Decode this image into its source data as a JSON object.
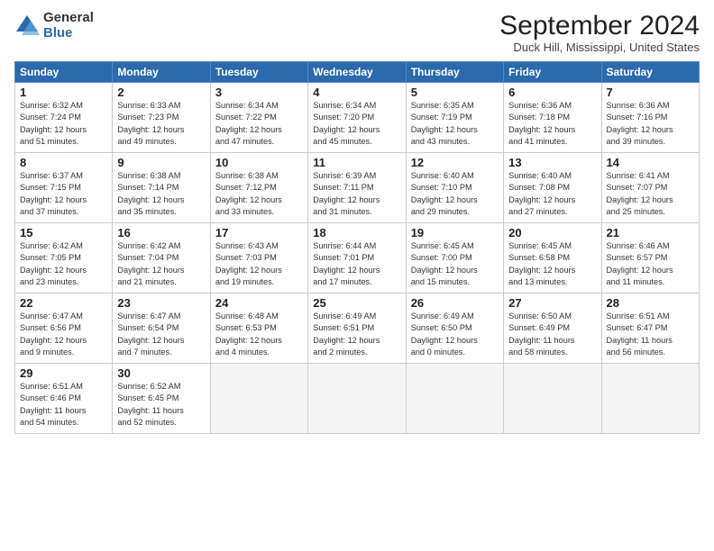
{
  "header": {
    "logo_general": "General",
    "logo_blue": "Blue",
    "month_title": "September 2024",
    "location": "Duck Hill, Mississippi, United States"
  },
  "days_of_week": [
    "Sunday",
    "Monday",
    "Tuesday",
    "Wednesday",
    "Thursday",
    "Friday",
    "Saturday"
  ],
  "weeks": [
    [
      {
        "day": "1",
        "info": "Sunrise: 6:32 AM\nSunset: 7:24 PM\nDaylight: 12 hours\nand 51 minutes."
      },
      {
        "day": "2",
        "info": "Sunrise: 6:33 AM\nSunset: 7:23 PM\nDaylight: 12 hours\nand 49 minutes."
      },
      {
        "day": "3",
        "info": "Sunrise: 6:34 AM\nSunset: 7:22 PM\nDaylight: 12 hours\nand 47 minutes."
      },
      {
        "day": "4",
        "info": "Sunrise: 6:34 AM\nSunset: 7:20 PM\nDaylight: 12 hours\nand 45 minutes."
      },
      {
        "day": "5",
        "info": "Sunrise: 6:35 AM\nSunset: 7:19 PM\nDaylight: 12 hours\nand 43 minutes."
      },
      {
        "day": "6",
        "info": "Sunrise: 6:36 AM\nSunset: 7:18 PM\nDaylight: 12 hours\nand 41 minutes."
      },
      {
        "day": "7",
        "info": "Sunrise: 6:36 AM\nSunset: 7:16 PM\nDaylight: 12 hours\nand 39 minutes."
      }
    ],
    [
      {
        "day": "8",
        "info": "Sunrise: 6:37 AM\nSunset: 7:15 PM\nDaylight: 12 hours\nand 37 minutes."
      },
      {
        "day": "9",
        "info": "Sunrise: 6:38 AM\nSunset: 7:14 PM\nDaylight: 12 hours\nand 35 minutes."
      },
      {
        "day": "10",
        "info": "Sunrise: 6:38 AM\nSunset: 7:12 PM\nDaylight: 12 hours\nand 33 minutes."
      },
      {
        "day": "11",
        "info": "Sunrise: 6:39 AM\nSunset: 7:11 PM\nDaylight: 12 hours\nand 31 minutes."
      },
      {
        "day": "12",
        "info": "Sunrise: 6:40 AM\nSunset: 7:10 PM\nDaylight: 12 hours\nand 29 minutes."
      },
      {
        "day": "13",
        "info": "Sunrise: 6:40 AM\nSunset: 7:08 PM\nDaylight: 12 hours\nand 27 minutes."
      },
      {
        "day": "14",
        "info": "Sunrise: 6:41 AM\nSunset: 7:07 PM\nDaylight: 12 hours\nand 25 minutes."
      }
    ],
    [
      {
        "day": "15",
        "info": "Sunrise: 6:42 AM\nSunset: 7:05 PM\nDaylight: 12 hours\nand 23 minutes."
      },
      {
        "day": "16",
        "info": "Sunrise: 6:42 AM\nSunset: 7:04 PM\nDaylight: 12 hours\nand 21 minutes."
      },
      {
        "day": "17",
        "info": "Sunrise: 6:43 AM\nSunset: 7:03 PM\nDaylight: 12 hours\nand 19 minutes."
      },
      {
        "day": "18",
        "info": "Sunrise: 6:44 AM\nSunset: 7:01 PM\nDaylight: 12 hours\nand 17 minutes."
      },
      {
        "day": "19",
        "info": "Sunrise: 6:45 AM\nSunset: 7:00 PM\nDaylight: 12 hours\nand 15 minutes."
      },
      {
        "day": "20",
        "info": "Sunrise: 6:45 AM\nSunset: 6:58 PM\nDaylight: 12 hours\nand 13 minutes."
      },
      {
        "day": "21",
        "info": "Sunrise: 6:46 AM\nSunset: 6:57 PM\nDaylight: 12 hours\nand 11 minutes."
      }
    ],
    [
      {
        "day": "22",
        "info": "Sunrise: 6:47 AM\nSunset: 6:56 PM\nDaylight: 12 hours\nand 9 minutes."
      },
      {
        "day": "23",
        "info": "Sunrise: 6:47 AM\nSunset: 6:54 PM\nDaylight: 12 hours\nand 7 minutes."
      },
      {
        "day": "24",
        "info": "Sunrise: 6:48 AM\nSunset: 6:53 PM\nDaylight: 12 hours\nand 4 minutes."
      },
      {
        "day": "25",
        "info": "Sunrise: 6:49 AM\nSunset: 6:51 PM\nDaylight: 12 hours\nand 2 minutes."
      },
      {
        "day": "26",
        "info": "Sunrise: 6:49 AM\nSunset: 6:50 PM\nDaylight: 12 hours\nand 0 minutes."
      },
      {
        "day": "27",
        "info": "Sunrise: 6:50 AM\nSunset: 6:49 PM\nDaylight: 11 hours\nand 58 minutes."
      },
      {
        "day": "28",
        "info": "Sunrise: 6:51 AM\nSunset: 6:47 PM\nDaylight: 11 hours\nand 56 minutes."
      }
    ],
    [
      {
        "day": "29",
        "info": "Sunrise: 6:51 AM\nSunset: 6:46 PM\nDaylight: 11 hours\nand 54 minutes."
      },
      {
        "day": "30",
        "info": "Sunrise: 6:52 AM\nSunset: 6:45 PM\nDaylight: 11 hours\nand 52 minutes."
      },
      {
        "day": "",
        "info": ""
      },
      {
        "day": "",
        "info": ""
      },
      {
        "day": "",
        "info": ""
      },
      {
        "day": "",
        "info": ""
      },
      {
        "day": "",
        "info": ""
      }
    ]
  ]
}
